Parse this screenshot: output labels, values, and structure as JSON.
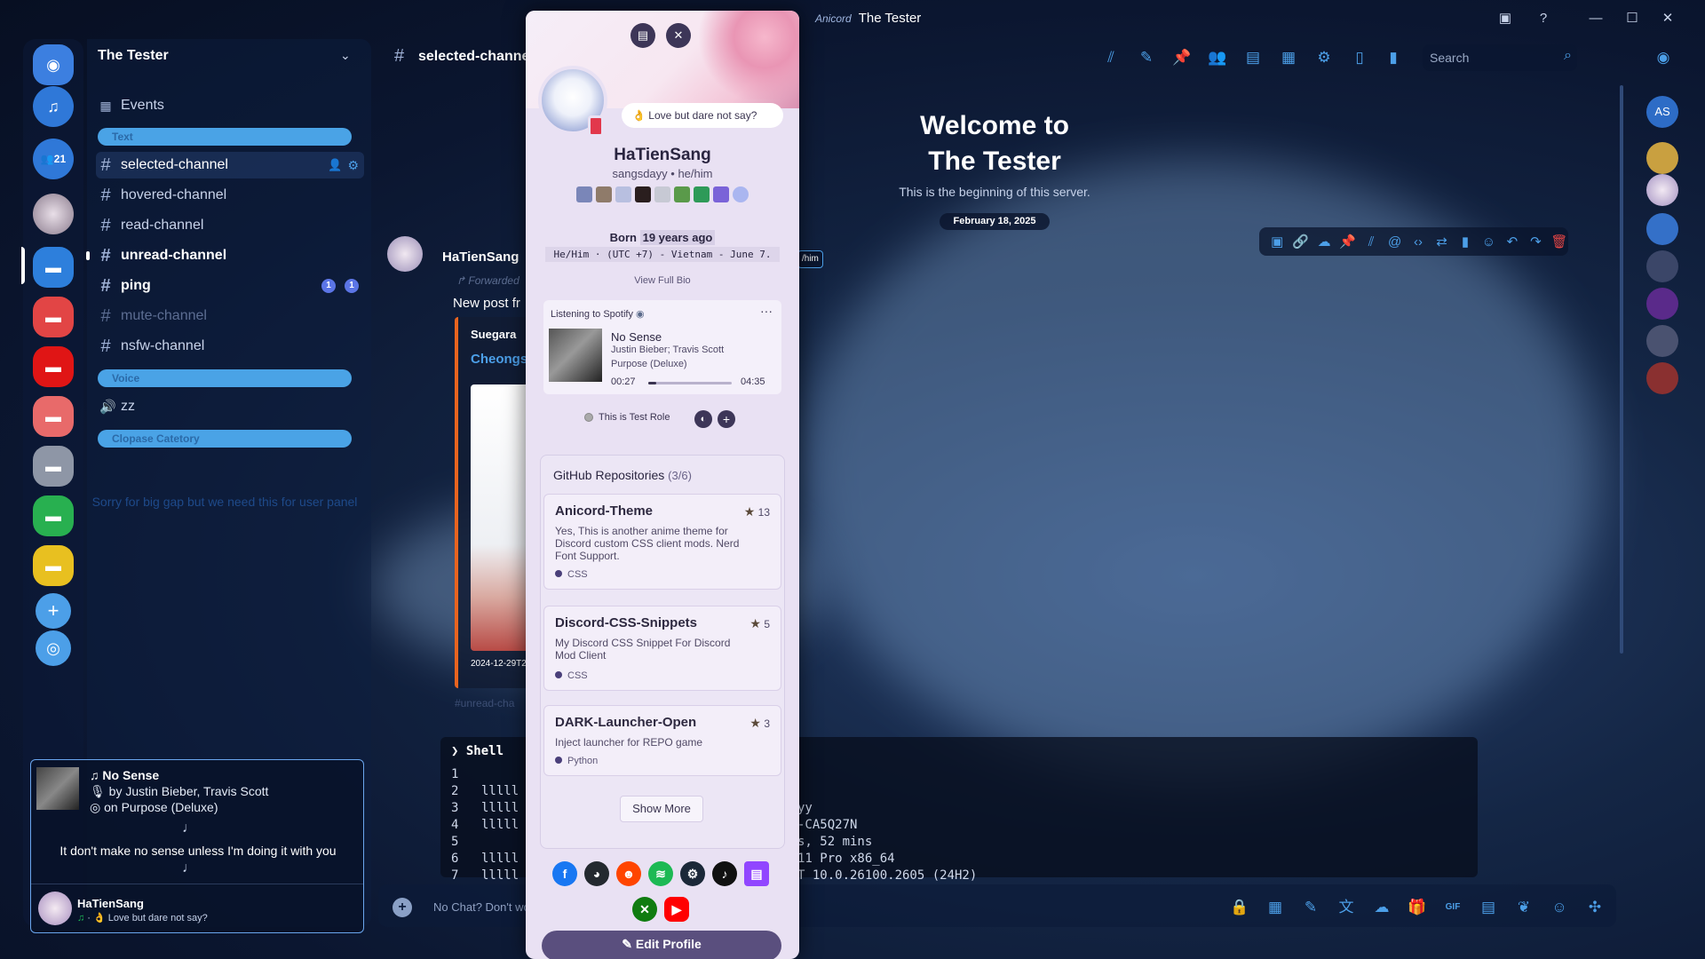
{
  "window": {
    "brand": "Anicord",
    "title": "The Tester"
  },
  "server": {
    "name": "The Tester",
    "badge_count": "21"
  },
  "channels": {
    "events_label": "Events",
    "categories": [
      "Text",
      "Voice",
      "Clopase Catetory"
    ],
    "items": [
      {
        "name": "selected-channel"
      },
      {
        "name": "hovered-channel"
      },
      {
        "name": "read-channel"
      },
      {
        "name": "unread-channel"
      },
      {
        "name": "ping",
        "badges": [
          "1",
          "1"
        ]
      },
      {
        "name": "mute-channel"
      },
      {
        "name": "nsfw-channel"
      }
    ],
    "voice_channel": "zz",
    "gap_note": "Sorry for big gap but we need this for user panel"
  },
  "header": {
    "channel_name": "selected-channel",
    "search_placeholder": "Search"
  },
  "welcome": {
    "title_line1": "Welcome to",
    "title_line2": "The Tester",
    "subtitle": "This is the beginning of this server.",
    "date": "February 18, 2025"
  },
  "message": {
    "author": "HaTienSang",
    "forwarded_label": "Forwarded",
    "text": "New post fr",
    "embed_author": "Suegara",
    "embed_title": "Cheongsa",
    "embed_timestamp": "2024-12-29T2",
    "footer_channel": "#unread-cha",
    "pronoun_tag": "/him"
  },
  "code": {
    "lang": "Shell",
    "line_numbers": [
      "1",
      "2",
      "3",
      "4",
      "5",
      "6",
      "7"
    ],
    "left_lines": [
      "",
      "lllll",
      "lllll",
      "lllll",
      "",
      "lllll",
      "lllll"
    ],
    "right_lines": [
      "",
      "",
      "yy",
      "-CA5Q27N",
      "s, 52 mins",
      "11 Pro x86_64",
      "T 10.0.26100.2605 (24H2)"
    ]
  },
  "input": {
    "placeholder": "No Chat? Don't wo"
  },
  "members": {
    "top_initials": "AS"
  },
  "now_playing": {
    "track": "No Sense",
    "artist_line": "by Justin Bieber, Travis Scott",
    "album_line": "on Purpose (Deluxe)",
    "lyric": "It don't make no sense unless I'm doing it with you"
  },
  "user_panel": {
    "name": "HaTienSang",
    "status": "Love but dare not say?"
  },
  "profile": {
    "status_bubble": "Love but dare not say?",
    "display_name": "HaTienSang",
    "username": "sangsdayy",
    "pronouns": "he/him",
    "born_label": "Born",
    "born_value": "19 years ago",
    "bio_line": "He/Him · (UTC +7) - Vietnam - June 7.",
    "view_bio": "View Full Bio",
    "spotify": {
      "label": "Listening to Spotify",
      "track": "No Sense",
      "artists": "Justin Bieber; Travis Scott",
      "album": "Purpose (Deluxe)",
      "elapsed": "00:27",
      "duration": "04:35",
      "progress": 0.1
    },
    "role": "This is Test Role",
    "github": {
      "title": "GitHub Repositories",
      "count": "(3/6)",
      "repos": [
        {
          "name": "Anicord-Theme",
          "stars": "13",
          "desc": "Yes, This is another anime theme for Discord custom CSS client mods. Nerd Font Support.",
          "lang": "CSS"
        },
        {
          "name": "Discord-CSS-Snippets",
          "stars": "5",
          "desc": "My Discord CSS Snippet For Discord Mod Client",
          "lang": "CSS"
        },
        {
          "name": "DARK-Launcher-Open",
          "stars": "3",
          "desc": "Inject launcher for REPO game",
          "lang": "Python"
        }
      ],
      "show_more": "Show More"
    },
    "edit_button": "Edit Profile"
  },
  "colors": {
    "accent": "#4c9fe8",
    "category": "#4aa3e6",
    "popout_bg": "#e9e1f3",
    "edit_button": "#5a4f7e"
  }
}
